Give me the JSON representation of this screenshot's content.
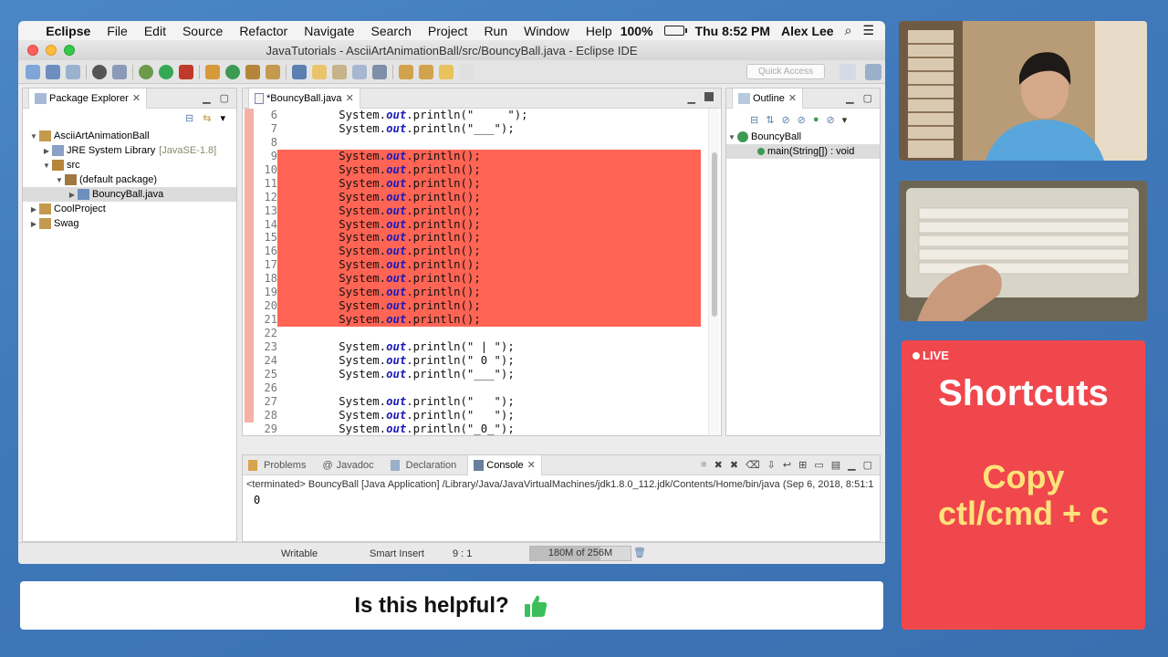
{
  "menubar": {
    "app": "Eclipse",
    "items": [
      "File",
      "Edit",
      "Source",
      "Refactor",
      "Navigate",
      "Search",
      "Project",
      "Run",
      "Window",
      "Help"
    ],
    "battery": "100%",
    "clock": "Thu 8:52 PM",
    "user": "Alex Lee"
  },
  "window": {
    "title": "JavaTutorials - AsciiArtAnimationBall/src/BouncyBall.java - Eclipse IDE",
    "quick_access_placeholder": "Quick Access"
  },
  "package_explorer": {
    "title": "Package Explorer",
    "tree": [
      {
        "label": "AsciiArtAnimationBall",
        "depth": 0,
        "expanded": true,
        "icon": "project-icon"
      },
      {
        "label": "JRE System Library",
        "extra": "[JavaSE-1.8]",
        "depth": 1,
        "expanded": false,
        "icon": "library-icon"
      },
      {
        "label": "src",
        "depth": 1,
        "expanded": true,
        "icon": "folder-icon"
      },
      {
        "label": "(default package)",
        "depth": 2,
        "expanded": true,
        "icon": "package-icon"
      },
      {
        "label": "BouncyBall.java",
        "depth": 3,
        "expanded": false,
        "icon": "java-file-icon",
        "selected": true
      },
      {
        "label": "CoolProject",
        "depth": 0,
        "expanded": false,
        "icon": "project-icon"
      },
      {
        "label": "Swag",
        "depth": 0,
        "expanded": false,
        "icon": "project-icon"
      }
    ]
  },
  "editor": {
    "tab": "*BouncyBall.java",
    "lines": [
      {
        "n": "6",
        "pre": "        System.",
        "out": "out",
        "post": ".println(\"     \");",
        "hl": false
      },
      {
        "n": "7",
        "pre": "        System.",
        "out": "out",
        "post": ".println(\"___\");",
        "hl": false
      },
      {
        "n": "8",
        "pre": "",
        "out": "",
        "post": "",
        "hl": false
      },
      {
        "n": "9",
        "pre": "        System.",
        "out": "out",
        "post": ".println();",
        "hl": true
      },
      {
        "n": "10",
        "pre": "        System.",
        "out": "out",
        "post": ".println();",
        "hl": true
      },
      {
        "n": "11",
        "pre": "        System.",
        "out": "out",
        "post": ".println();",
        "hl": true
      },
      {
        "n": "12",
        "pre": "        System.",
        "out": "out",
        "post": ".println();",
        "hl": true
      },
      {
        "n": "13",
        "pre": "        System.",
        "out": "out",
        "post": ".println();",
        "hl": true
      },
      {
        "n": "14",
        "pre": "        System.",
        "out": "out",
        "post": ".println();",
        "hl": true
      },
      {
        "n": "15",
        "pre": "        System.",
        "out": "out",
        "post": ".println();",
        "hl": true
      },
      {
        "n": "16",
        "pre": "        System.",
        "out": "out",
        "post": ".println();",
        "hl": true
      },
      {
        "n": "17",
        "pre": "        System.",
        "out": "out",
        "post": ".println();",
        "hl": true
      },
      {
        "n": "18",
        "pre": "        System.",
        "out": "out",
        "post": ".println();",
        "hl": true
      },
      {
        "n": "19",
        "pre": "        System.",
        "out": "out",
        "post": ".println();",
        "hl": true
      },
      {
        "n": "20",
        "pre": "        System.",
        "out": "out",
        "post": ".println();",
        "hl": true
      },
      {
        "n": "21",
        "pre": "        System.",
        "out": "out",
        "post": ".println();",
        "hl": true
      },
      {
        "n": "22",
        "pre": "",
        "out": "",
        "post": "",
        "hl": false
      },
      {
        "n": "23",
        "pre": "        System.",
        "out": "out",
        "post": ".println(\" | \");",
        "hl": false
      },
      {
        "n": "24",
        "pre": "        System.",
        "out": "out",
        "post": ".println(\" 0 \");",
        "hl": false
      },
      {
        "n": "25",
        "pre": "        System.",
        "out": "out",
        "post": ".println(\"___\");",
        "hl": false
      },
      {
        "n": "26",
        "pre": "",
        "out": "",
        "post": "",
        "hl": false
      },
      {
        "n": "27",
        "pre": "        System.",
        "out": "out",
        "post": ".println(\"   \");",
        "hl": false
      },
      {
        "n": "28",
        "pre": "        System.",
        "out": "out",
        "post": ".println(\"   \");",
        "hl": false
      },
      {
        "n": "29",
        "pre": "        System.",
        "out": "out",
        "post": ".println(\"_0_\");",
        "hl": false
      }
    ]
  },
  "outline": {
    "title": "Outline",
    "class": "BouncyBall",
    "method": "main(String[]) : void"
  },
  "bottom": {
    "tabs": [
      "Problems",
      "Javadoc",
      "Declaration",
      "Console"
    ],
    "active_tab": "Console",
    "terminated": "<terminated> BouncyBall [Java Application] /Library/Java/JavaVirtualMachines/jdk1.8.0_112.jdk/Contents/Home/bin/java (Sep 6, 2018, 8:51:1",
    "output": "0"
  },
  "status": {
    "writable": "Writable",
    "insert": "Smart Insert",
    "position": "9 : 1",
    "heap": "180M of 256M",
    "heap_fraction": 0.7
  },
  "helpful": {
    "text": "Is this helpful?"
  },
  "card": {
    "live": "LIVE",
    "title": "Shortcuts",
    "line1": "Copy",
    "line2": "ctl/cmd + c"
  },
  "colors": {
    "highlight": "#ff6454",
    "card_bg": "#f0474d",
    "card_accent": "#ffe27a",
    "desktop": "#3f79bb"
  }
}
